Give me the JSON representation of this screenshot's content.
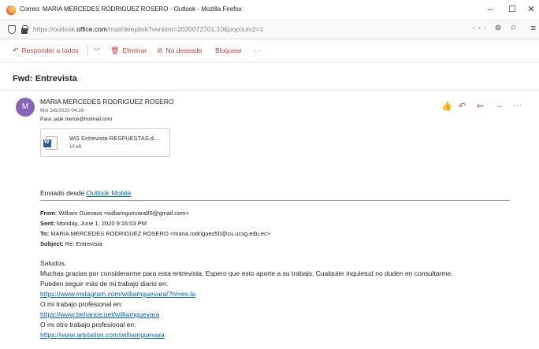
{
  "window": {
    "title": "Correo: MARIA MERCEDES RODRIGUEZ ROSERO - Outlook - Mozilla Firefox",
    "minimize": "–",
    "maximize": "☐",
    "close": "✕"
  },
  "address_bar": {
    "url_prefix": "https://outlook.",
    "url_host": "office.com",
    "url_suffix": "/mail/deeplink?version=2020072701.10&popoutv2=1",
    "actions": "··· ⊚ ☆",
    "menu": "≡"
  },
  "toolbar": {
    "reply_all": "Responder a todos",
    "dropdown": "﹀",
    "delete": "Eliminar",
    "junk": "No deseado",
    "block": "Bloquear",
    "more": "···"
  },
  "message": {
    "subject": "Fwd: Entrevista",
    "avatar_initial": "M",
    "sender": "MARIA MERCEDES RODRIGUEZ ROSERO",
    "date": "Mié 3/6/2020 04:16",
    "to_label": "Para:",
    "to": "jade.merce@hotmail.com",
    "actions": {
      "like": "👍",
      "reply": "↶",
      "reply_all": "⇐",
      "forward": "→",
      "more": "···"
    },
    "attachment": {
      "name": "WG Entrevista-RESPUESTAS.d...",
      "size": "19 kB"
    },
    "sent_from_prefix": "Enviado desde ",
    "sent_from_link": "Outlook Mobile",
    "forwarded": {
      "from_label": "From:",
      "from": "William Guevara <williamguevara95@gmail.com>",
      "sent_label": "Sent:",
      "sent": "Monday, June 1, 2020 9:16:03 PM",
      "to_label": "To:",
      "to": "MARIA MERCEDES RODRIGUEZ ROSERO <maria.rodriguez50@cu.ucsg.edu.ec>",
      "subject_label": "Subject:",
      "subject": "Re: Entrevista"
    },
    "body": {
      "greeting": "Saludos,",
      "line1": "Muchas gracias por considerarme para esta entrevista. Espero que esto aporte a su trabajo. Cualquier inquietud no duden en consultarme.",
      "line2": "Pueden seguir más de mi trabajo diario en:",
      "link1": "https://www.instagram.com/williamguevara/?hl=es-la",
      "line3": "O mi trabajo profesional en:",
      "link2": "https://www.behance.net/williamguevara",
      "line4": "O mi otro trabajo profesional en:",
      "link3": "https://www.artstation.com/williamguevara"
    }
  }
}
